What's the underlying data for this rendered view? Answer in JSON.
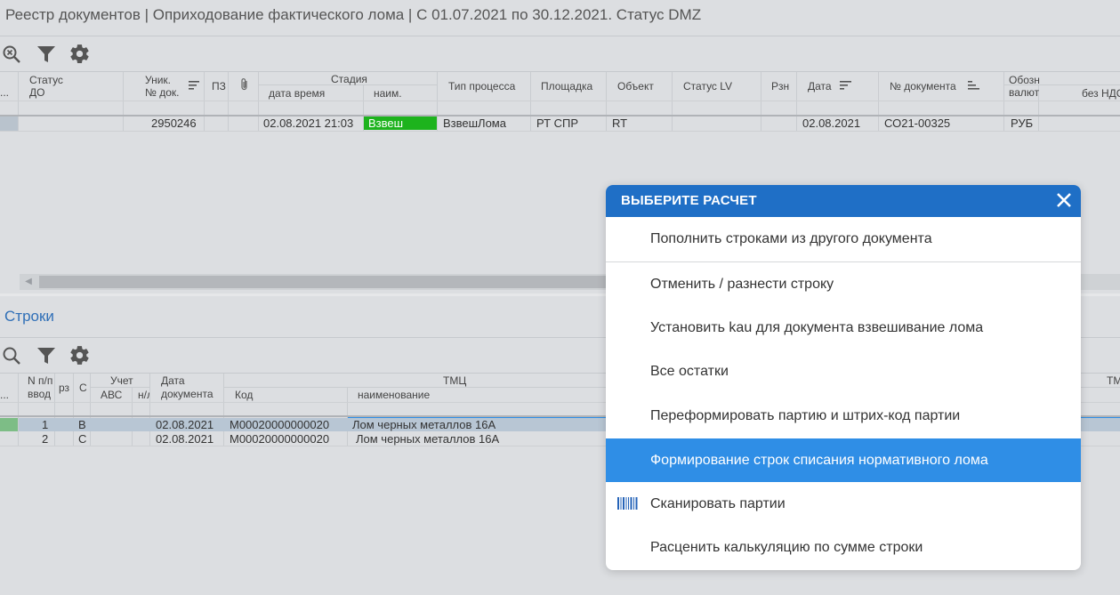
{
  "window": {
    "title": "Реестр документов | Оприходование фактического лома | С 01.07.2021 по 30.12.2021. Статус DMZ"
  },
  "toolbar_top": {
    "icons": [
      "zoom-icon",
      "filter-icon",
      "gear-icon"
    ]
  },
  "top_table": {
    "headers": {
      "more": "...",
      "status_do_1": "Статус",
      "status_do_2": "ДО",
      "unique_1": "Уник.",
      "unique_2": "№ док.",
      "pz": "ПЗ",
      "stage": "Стадия",
      "stage_datetime": "дата время",
      "stage_name": "наим.",
      "process_type": "Тип процесса",
      "site": "Площадка",
      "object": "Объект",
      "status_lv": "Статус LV",
      "rzn": "Рзн",
      "date": "Дата",
      "doc_number": "№ документа",
      "currency_1": "Обозн",
      "currency_2": "валют",
      "no_vat": "без НДС"
    },
    "row": {
      "unique": "2950246",
      "stage_datetime": "02.08.2021 21:03",
      "stage_name": "Взвеш",
      "process_type": "ВзвешЛома",
      "site": "РТ СПР",
      "object": "RT",
      "date": "02.08.2021",
      "doc_number": "СО21-00325",
      "currency": "РУБ"
    }
  },
  "lines_section": {
    "title": "Строки"
  },
  "toolbar_lines": {
    "icons": [
      "search-icon",
      "filter-icon",
      "gear-icon"
    ]
  },
  "lines_table": {
    "headers": {
      "more": "...",
      "np_1": "N п/п",
      "np_2": "ввод",
      "rz": "рз",
      "c": "С",
      "uchet": "Учет",
      "abc": "АВС",
      "nl": "н/л",
      "date_1": "Дата",
      "date_2": "документа",
      "tmc": "ТМЦ",
      "code": "Код",
      "name": "наименование",
      "tm_right": "ТМ"
    },
    "rows": [
      {
        "n": "1",
        "c": "В",
        "date": "02.08.2021",
        "code": "М00020000000020",
        "name": "Лом черных металлов 16А"
      },
      {
        "n": "2",
        "c": "С",
        "date": "02.08.2021",
        "code": "М00020000000020",
        "name": "Лом черных металлов 16А"
      }
    ]
  },
  "modal": {
    "title": "ВЫБЕРИТЕ РАСЧЕТ",
    "items": [
      {
        "label": "Пополнить строками из другого документа"
      },
      {
        "label": "Отменить / разнести строку"
      },
      {
        "label": "Установить kau для документа взвешивание лома"
      },
      {
        "label": "Все остатки"
      },
      {
        "label": "Переформировать партию и штрих-код партии"
      },
      {
        "label": "Формирование строк списания нормативного лома"
      },
      {
        "label": "Сканировать партии",
        "icon": "barcode-icon"
      },
      {
        "label": "Расценить калькуляцию по сумме строки"
      }
    ],
    "active_index": 5
  },
  "colors": {
    "accent": "#1f6fc6",
    "active_item": "#2f8ee6",
    "stage_badge": "#1db31d",
    "section_title": "#2f6fb7"
  }
}
